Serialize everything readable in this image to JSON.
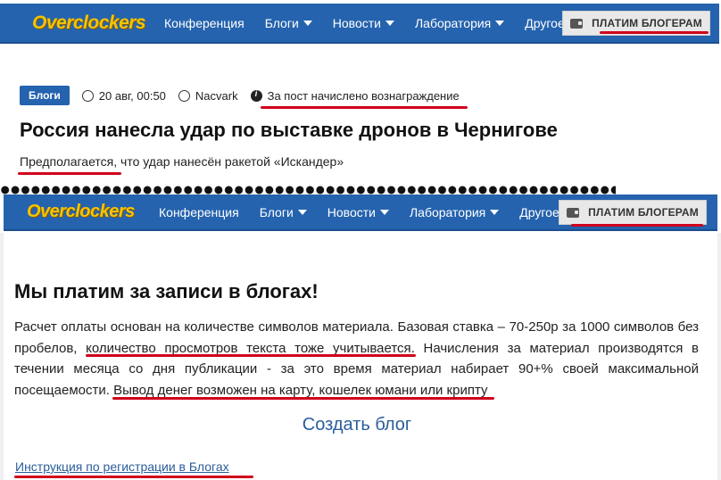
{
  "top_nav": {
    "logo": "Overclockers",
    "menu": [
      {
        "label": "Конференция",
        "dropdown": false
      },
      {
        "label": "Блоги",
        "dropdown": true
      },
      {
        "label": "Новости",
        "dropdown": true
      },
      {
        "label": "Лаборатория",
        "dropdown": true
      },
      {
        "label": "Другое",
        "dropdown": true
      }
    ],
    "pay_button": "ПЛАТИМ БЛОГЕРАМ"
  },
  "article": {
    "category_badge": "Блоги",
    "date": "20 авг, 00:50",
    "author": "Nacvark",
    "reward_notice": "За пост начислено вознаграждение",
    "title": "Россия нанесла удар по выставке дронов в Чернигове",
    "subtitle_underlined": "Предполагается",
    "subtitle_rest": ", что удар нанесён ракетой «Искандер»"
  },
  "blog_page": {
    "heading": "Мы платим за записи в блогах!",
    "para_1": "Расчет оплаты основан на количестве символов материала. Базовая ставка – 70-250р за 1000 символов без пробелов, ",
    "para_2": "количество просмотров текста тоже учитывается",
    "para_3": ". Начисления за материал производятся в течении месяца со дня публикации - за это время материал набирает 90+% своей максимальной посещаемости. ",
    "para_4": "Вывод денег возможен на карту, кошелек юмани или крипту",
    "create_blog": "Создать блог",
    "instruction_link": "Инструкция по регистрации в Блогах"
  },
  "colors": {
    "nav": "#2563ae",
    "logo": "#f5c400",
    "underline": "#d0021b",
    "link": "#2b5d9b"
  }
}
